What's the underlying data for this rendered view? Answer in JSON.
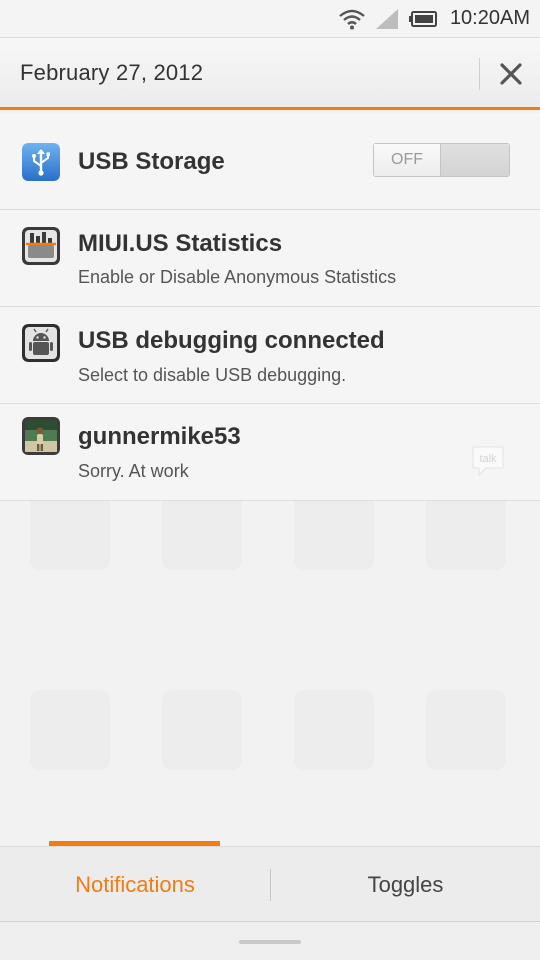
{
  "status_bar": {
    "time": "10:20AM",
    "icons": [
      "wifi-icon",
      "signal-icon",
      "battery-icon"
    ]
  },
  "header": {
    "date": "February 27, 2012",
    "close_icon": "close-icon"
  },
  "notifications": [
    {
      "icon": "usb-icon",
      "title": "USB Storage",
      "toggle_label": "OFF",
      "toggle_on": false
    },
    {
      "icon": "miui-stats-icon",
      "title": "MIUI.US Statistics",
      "subtitle": "Enable or Disable Anonymous Statistics"
    },
    {
      "icon": "android-debug-icon",
      "title": "USB debugging connected",
      "subtitle": "Select to disable USB debugging."
    },
    {
      "icon": "avatar-photo",
      "title": "gunnermike53",
      "subtitle": "Sorry. At work",
      "badge": "talk"
    }
  ],
  "tabs": [
    {
      "label": "Notifications",
      "active": true
    },
    {
      "label": "Toggles",
      "active": false
    }
  ],
  "colors": {
    "accent": "#f07d12",
    "text": "#333333",
    "background": "#f2f2f2"
  }
}
